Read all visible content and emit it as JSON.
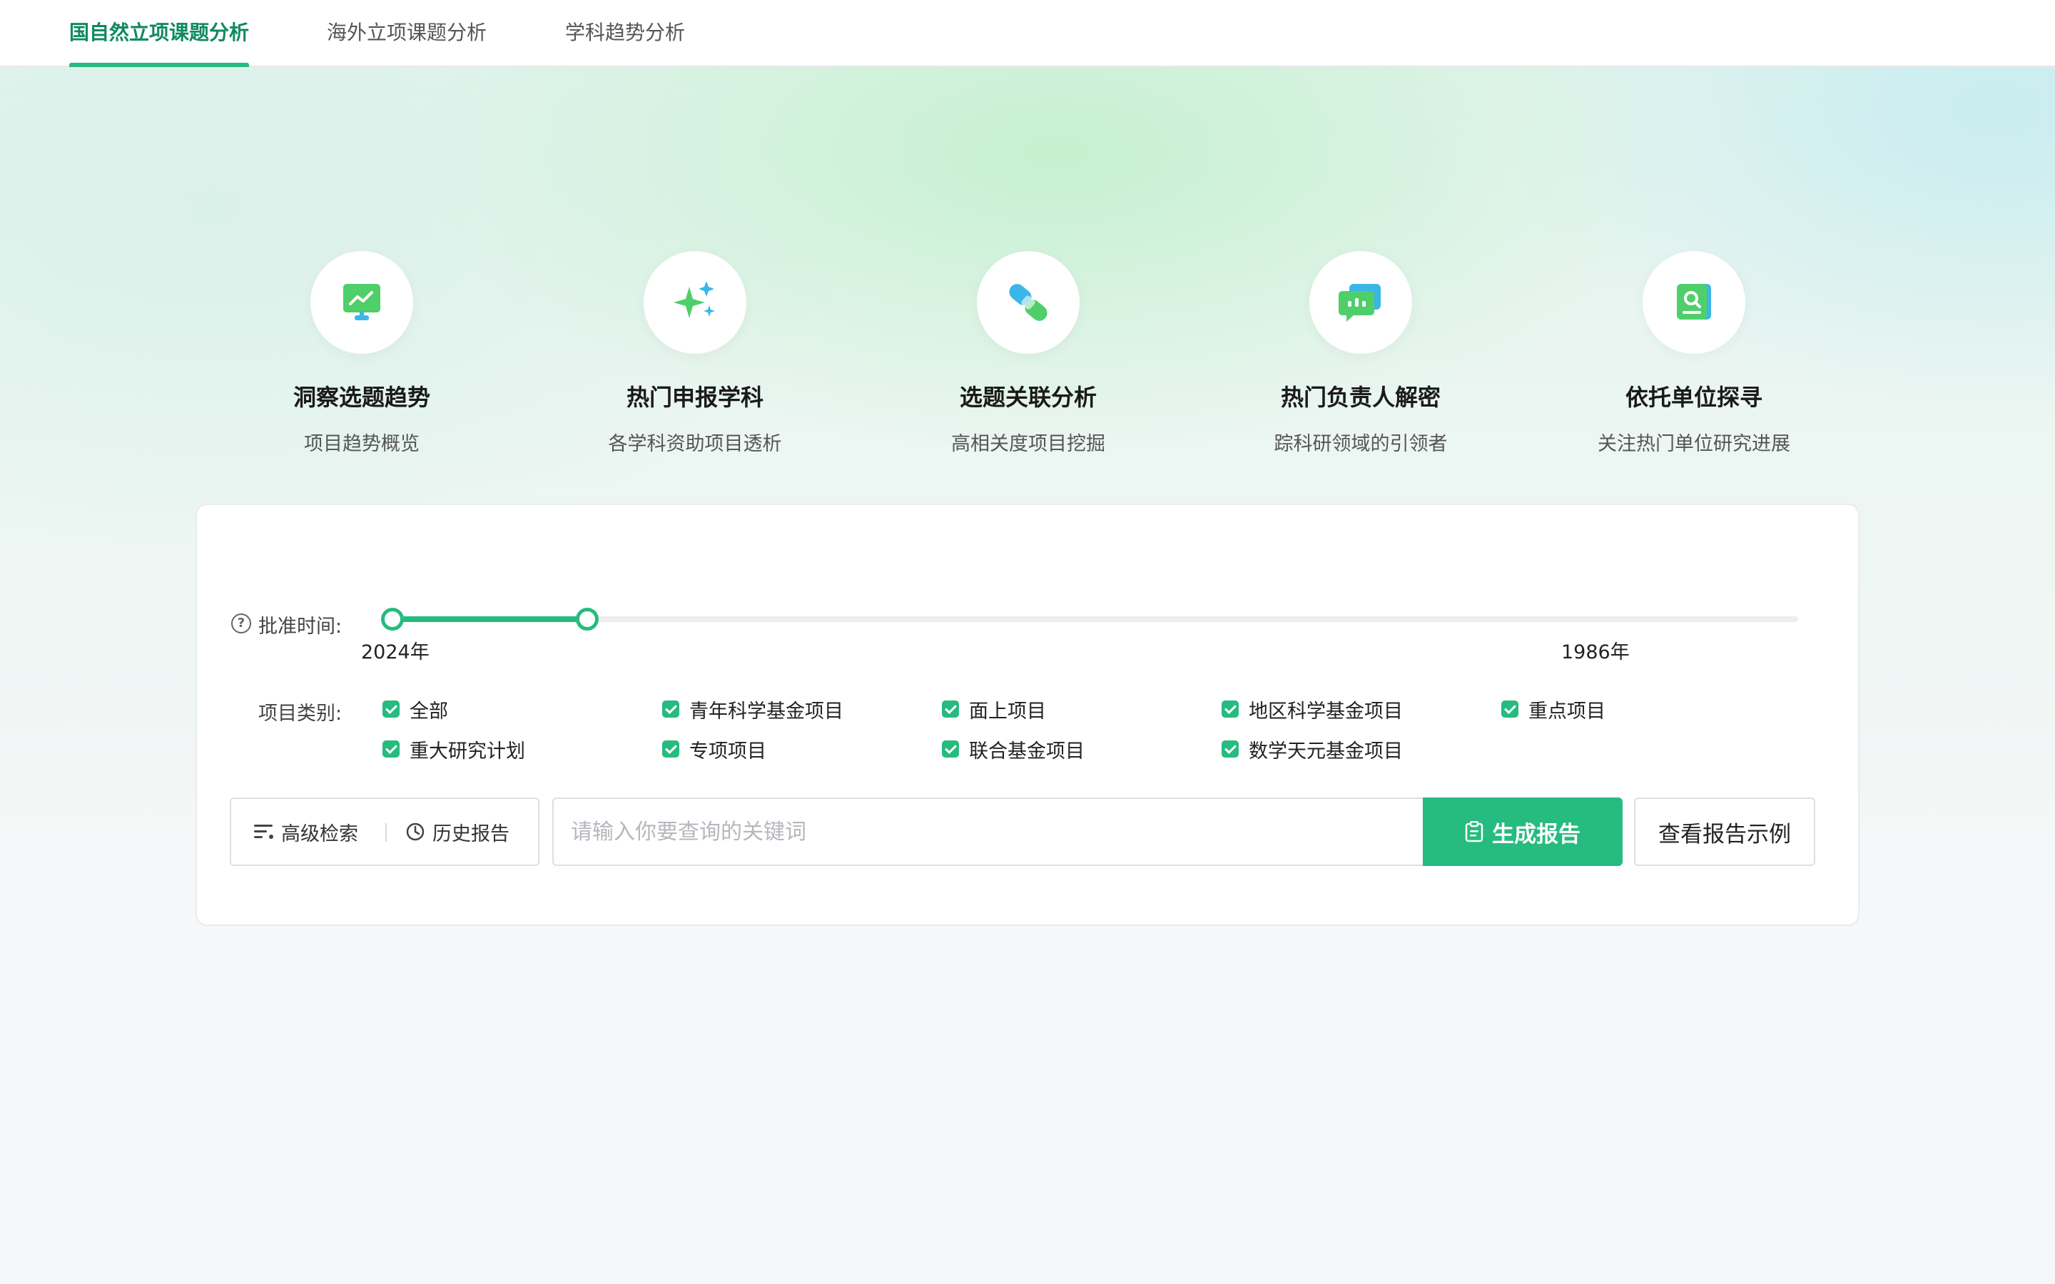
{
  "tabs": [
    {
      "label": "国自然立项课题分析",
      "active": true
    },
    {
      "label": "海外立项课题分析",
      "active": false
    },
    {
      "label": "学科趋势分析",
      "active": false
    }
  ],
  "features": [
    {
      "icon": "trend-chart-icon",
      "title": "洞察选题趋势",
      "subtitle": "项目趋势概览"
    },
    {
      "icon": "sparkle-icon",
      "title": "热门申报学科",
      "subtitle": "各学科资助项目透析"
    },
    {
      "icon": "link-icon",
      "title": "选题关联分析",
      "subtitle": "高相关度项目挖掘"
    },
    {
      "icon": "chat-icon",
      "title": "热门负责人解密",
      "subtitle": "踪科研领域的引领者"
    },
    {
      "icon": "book-search-icon",
      "title": "依托单位探寻",
      "subtitle": "关注热门单位研究进展"
    }
  ],
  "filters": {
    "time_label": "批准时间:",
    "time_start": "2024年",
    "time_end": "1986年",
    "category_label": "项目类别:",
    "categories": [
      {
        "label": "全部",
        "checked": true
      },
      {
        "label": "青年科学基金项目",
        "checked": true
      },
      {
        "label": "面上项目",
        "checked": true
      },
      {
        "label": "地区科学基金项目",
        "checked": true
      },
      {
        "label": "重点项目",
        "checked": true
      },
      {
        "label": "重大研究计划",
        "checked": true
      },
      {
        "label": "专项项目",
        "checked": true
      },
      {
        "label": "联合基金项目",
        "checked": true
      },
      {
        "label": "数学天元基金项目",
        "checked": true
      }
    ]
  },
  "actions": {
    "advanced_search": "高级检索",
    "history_report": "历史报告",
    "search_placeholder": "请输入你要查询的关键词",
    "generate_report": "生成报告",
    "view_example": "查看报告示例"
  },
  "colors": {
    "accent": "#26bb7f",
    "accent_text": "#0f8a5f"
  }
}
